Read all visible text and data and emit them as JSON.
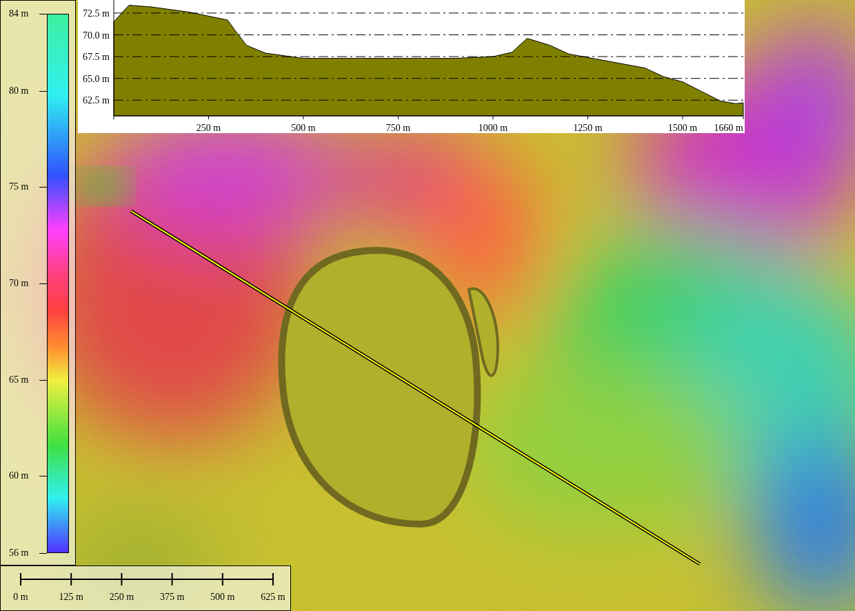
{
  "legend": {
    "labels": [
      "84 m",
      "80 m",
      "75 m",
      "70 m",
      "65 m",
      "60 m",
      "56 m"
    ]
  },
  "profile": {
    "chart_data": {
      "type": "area",
      "x": [
        0,
        40,
        100,
        200,
        300,
        320,
        350,
        400,
        450,
        500,
        600,
        700,
        800,
        900,
        1000,
        1050,
        1090,
        1150,
        1200,
        1250,
        1300,
        1400,
        1450,
        1500,
        1550,
        1600,
        1640,
        1660
      ],
      "series": [
        {
          "color": "#808000",
          "values": [
            71.5,
            73.4,
            73.2,
            72.6,
            71.7,
            70.5,
            68.8,
            67.9,
            67.6,
            67.3,
            67.3,
            67.3,
            67.3,
            67.3,
            67.5,
            68.0,
            69.6,
            68.8,
            67.8,
            67.4,
            67.0,
            66.2,
            65.2,
            64.6,
            63.5,
            62.4,
            62.1,
            62.2
          ]
        }
      ],
      "xlim": [
        0,
        1660
      ],
      "ylim": [
        60.7,
        74
      ],
      "grid": true,
      "xticks": [
        {
          "value": 250,
          "label": "250 m"
        },
        {
          "value": 500,
          "label": "500 m"
        },
        {
          "value": 750,
          "label": "750 m"
        },
        {
          "value": 1000,
          "label": "1000 m"
        },
        {
          "value": 1250,
          "label": "1250 m"
        },
        {
          "value": 1500,
          "label": "1500 m"
        },
        {
          "value": 1660,
          "label": "1660 m"
        }
      ],
      "yticks": [
        {
          "value": 62.5,
          "label": "62.5 m"
        },
        {
          "value": 65,
          "label": "65.0 m"
        },
        {
          "value": 67.5,
          "label": "67.5 m"
        },
        {
          "value": 70,
          "label": "70.0 m"
        },
        {
          "value": 72.5,
          "label": "72.5 m"
        }
      ]
    }
  },
  "scale_bar": {
    "labels": [
      "0 m",
      "125 m",
      "250 m",
      "375 m",
      "500 m",
      "625 m"
    ]
  }
}
